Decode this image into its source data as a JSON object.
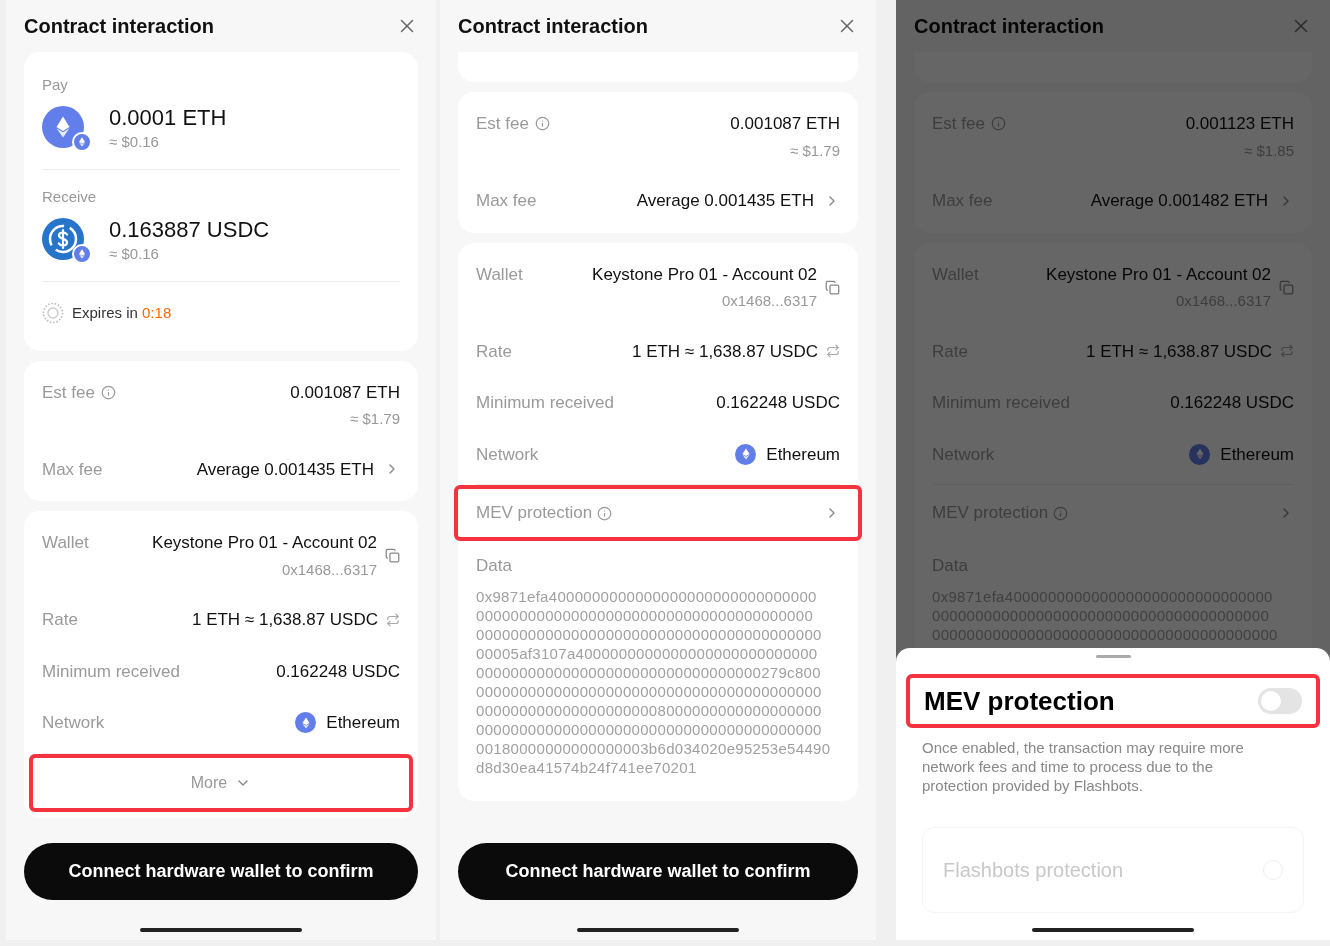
{
  "screens": [
    {
      "title": "Contract interaction",
      "cards": [
        {
          "kind": "full",
          "rows": [
            {
              "kind": "asset",
              "label": "Pay",
              "amount": "0.0001 ETH",
              "fiat": "≈ $0.16"
            },
            {
              "kind": "asset",
              "label": "Receive",
              "amount": "0.163887 USDC",
              "fiat": "≈ $0.16"
            },
            {
              "kind": "expiry",
              "label": "Expires in",
              "value": "0:18"
            }
          ]
        },
        {
          "kind": "full",
          "rows": [
            {
              "kind": "fee",
              "label": "Est fee",
              "value": "0.001087 ETH",
              "fiat": "≈ $1.79"
            },
            {
              "kind": "link",
              "label": "Max fee",
              "value": "Average 0.001435 ETH"
            }
          ]
        },
        {
          "kind": "full",
          "rows": [
            {
              "kind": "wallet",
              "label": "Wallet",
              "value": "Keystone Pro 01 - Account 02",
              "address": "0x1468...6317"
            },
            {
              "kind": "rate",
              "label": "Rate",
              "value": "1 ETH ≈ 1,638.87 USDC"
            },
            {
              "kind": "kv",
              "label": "Minimum received",
              "value": "0.162248 USDC"
            },
            {
              "kind": "network",
              "label": "Network",
              "value": "Ethereum"
            },
            {
              "kind": "more",
              "label": "More",
              "highlighted": true
            }
          ]
        }
      ],
      "button": "Connect hardware wallet to confirm"
    },
    {
      "title": "Contract interaction",
      "cards": [
        {
          "kind": "stub"
        },
        {
          "kind": "full",
          "rows": [
            {
              "kind": "fee",
              "label": "Est fee",
              "value": "0.001087 ETH",
              "fiat": "≈ $1.79"
            },
            {
              "kind": "link",
              "label": "Max fee",
              "value": "Average 0.001435 ETH"
            }
          ]
        },
        {
          "kind": "full",
          "rows": [
            {
              "kind": "wallet",
              "label": "Wallet",
              "value": "Keystone Pro 01 - Account 02",
              "address": "0x1468...6317"
            },
            {
              "kind": "rate",
              "label": "Rate",
              "value": "1 ETH ≈ 1,638.87 USDC"
            },
            {
              "kind": "kv",
              "label": "Minimum received",
              "value": "0.162248 USDC"
            },
            {
              "kind": "network",
              "label": "Network",
              "value": "Ethereum"
            },
            {
              "kind": "mev",
              "label": "MEV protection",
              "highlighted": true
            },
            {
              "kind": "data",
              "label": "Data",
              "lines": [
                "0x9871efa4000000000000000000000000000000",
                "000000000000000000000000000000000000000",
                "0000000000000000000000000000000000000000",
                "00005af3107a4000000000000000000000000000",
                "000000000000000000000000000000000279c800",
                "0000000000000000000000000000000000000000",
                "0000000000000000000008000000000000000000",
                "0000000000000000000000000000000000000000",
                "00180000000000000003b6d034020e95253e54490",
                "d8d30ea41574b24f741ee70201"
              ]
            }
          ]
        }
      ],
      "button": "Connect hardware wallet to confirm"
    },
    {
      "title": "Contract interaction",
      "cards": [
        {
          "kind": "stub"
        },
        {
          "kind": "full",
          "rows": [
            {
              "kind": "fee",
              "label": "Est fee",
              "value": "0.001123 ETH",
              "fiat": "≈ $1.85"
            },
            {
              "kind": "link",
              "label": "Max fee",
              "value": "Average 0.001482 ETH"
            }
          ]
        },
        {
          "kind": "full",
          "rows": [
            {
              "kind": "wallet",
              "label": "Wallet",
              "value": "Keystone Pro 01 - Account 02",
              "address": "0x1468...6317"
            },
            {
              "kind": "rate",
              "label": "Rate",
              "value": "1 ETH ≈ 1,638.87 USDC"
            },
            {
              "kind": "kv",
              "label": "Minimum received",
              "value": "0.162248 USDC"
            },
            {
              "kind": "network",
              "label": "Network",
              "value": "Ethereum"
            },
            {
              "kind": "mev",
              "label": "MEV protection",
              "highlighted": false
            },
            {
              "kind": "data",
              "label": "Data",
              "lines": [
                "0x9871efa4000000000000000000000000000000",
                "000000000000000000000000000000000000000",
                "0000000000000000000000000000000000000000"
              ]
            }
          ]
        }
      ],
      "sheet": {
        "title": "MEV protection",
        "highlighted": true,
        "on": false,
        "description": "Once enabled, the transaction may require more network fees and time to process due to the protection provided by Flashbots.",
        "option": {
          "label": "Flashbots protection",
          "disabled": true,
          "selected": false
        }
      }
    }
  ]
}
